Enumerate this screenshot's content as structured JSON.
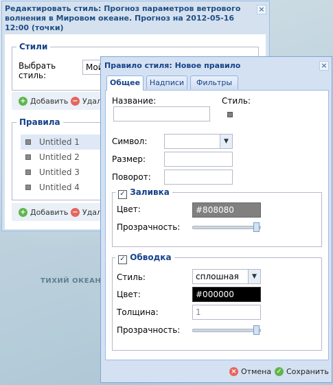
{
  "map": {
    "ocean_label": "ТИХИЙ ОКЕАН"
  },
  "edit_style_window": {
    "title": "Редактировать стиль: Прогноз параметров ветрового волнения в Мировом океане. Прогноз на 2012-05-16 12:00 (точки)",
    "close_icon": "close-icon",
    "styles": {
      "legend": "Стили",
      "select_label": "Выбрать стиль:",
      "select_value": "Мой",
      "add_label": "Добавить",
      "delete_label": "Удали"
    },
    "rules": {
      "legend": "Правила",
      "items": [
        "Untitled 1",
        "Untitled 2",
        "Untitled 3",
        "Untitled 4"
      ],
      "add_label": "Добавить",
      "delete_label": "Удали"
    }
  },
  "rule_window": {
    "title": "Правило стиля: Новое правило",
    "close_icon": "close-icon",
    "tabs": [
      "Общее",
      "Надписи",
      "Фильтры"
    ],
    "active_tab": "Общее",
    "general": {
      "name_label": "Название:",
      "name_value": "",
      "style_label": "Стиль:",
      "symbol_label": "Символ:",
      "symbol_value": "",
      "size_label": "Размер:",
      "size_value": "",
      "rotation_label": "Поворот:",
      "rotation_value": "",
      "fill": {
        "legend": "Заливка",
        "checked": true,
        "color_label": "Цвет:",
        "color_value": "#808080",
        "opacity_label": "Прозрачность:",
        "opacity_level": 1.0
      },
      "stroke": {
        "legend": "Обводка",
        "checked": true,
        "style_label": "Стиль:",
        "style_value": "сплошная",
        "color_label": "Цвет:",
        "color_value": "#000000",
        "width_label": "Толщина:",
        "width_value": "1",
        "opacity_label": "Прозрачность:",
        "opacity_level": 1.0
      }
    },
    "footer": {
      "cancel_label": "Отмена",
      "save_label": "Сохранить"
    }
  },
  "colors": {
    "accent": "#15428b",
    "fill_swatch": "#808080",
    "stroke_swatch": "#000000"
  }
}
